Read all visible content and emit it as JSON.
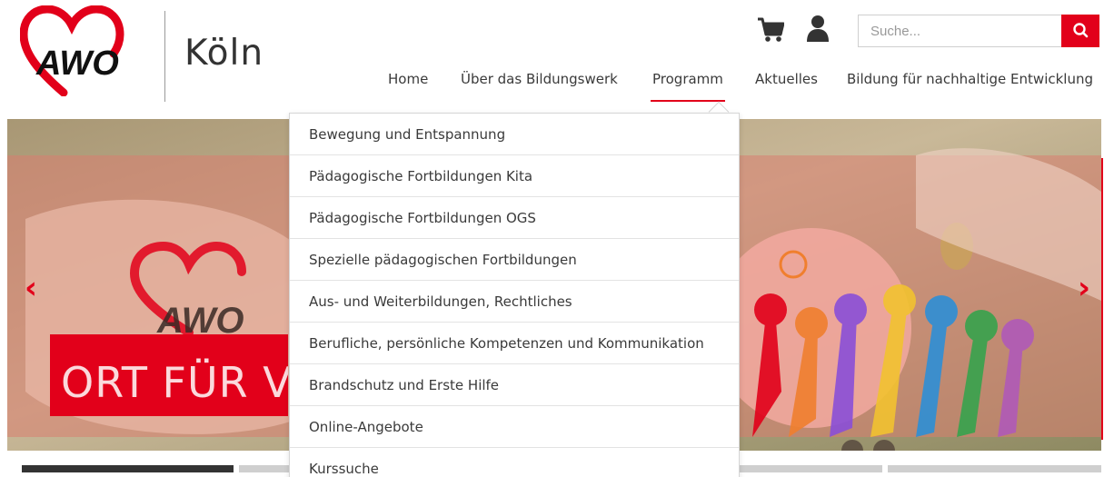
{
  "brand": {
    "logo_text": "AWO",
    "city": "Köln",
    "accent_color": "#e2001a"
  },
  "header": {
    "cart_icon": "cart-icon",
    "user_icon": "user-icon",
    "search": {
      "placeholder": "Suche...",
      "button_icon": "search-icon"
    }
  },
  "nav": {
    "items": [
      {
        "label": "Home"
      },
      {
        "label": "Über das Bildungswerk"
      },
      {
        "label": "Programm",
        "active": true
      },
      {
        "label": "Aktuelles"
      },
      {
        "label": "Bildung für nachhaltige Entwicklung"
      }
    ]
  },
  "dropdown": {
    "items": [
      {
        "label": "Bewegung und Entspannung"
      },
      {
        "label": "Pädagogische Fortbildungen Kita"
      },
      {
        "label": "Pädagogische Fortbildungen OGS"
      },
      {
        "label": "Spezielle pädagogischen Fortbildungen"
      },
      {
        "label": "Aus- und Weiterbildungen, Rechtliches"
      },
      {
        "label": "Berufliche, persönliche Kompetenzen und Kommunikation"
      },
      {
        "label": "Brandschutz und Erste Hilfe"
      },
      {
        "label": "Online-Angebote"
      },
      {
        "label": "Kurssuche"
      }
    ]
  },
  "hero": {
    "logo_text": "AWO",
    "banner_text": "ORT FÜR V",
    "prev_icon": "chevron-left-icon",
    "next_icon": "chevron-right-icon",
    "slides": [
      {
        "active": true
      },
      {
        "active": false
      },
      {
        "active": false
      },
      {
        "active": false
      },
      {
        "active": false
      }
    ]
  }
}
